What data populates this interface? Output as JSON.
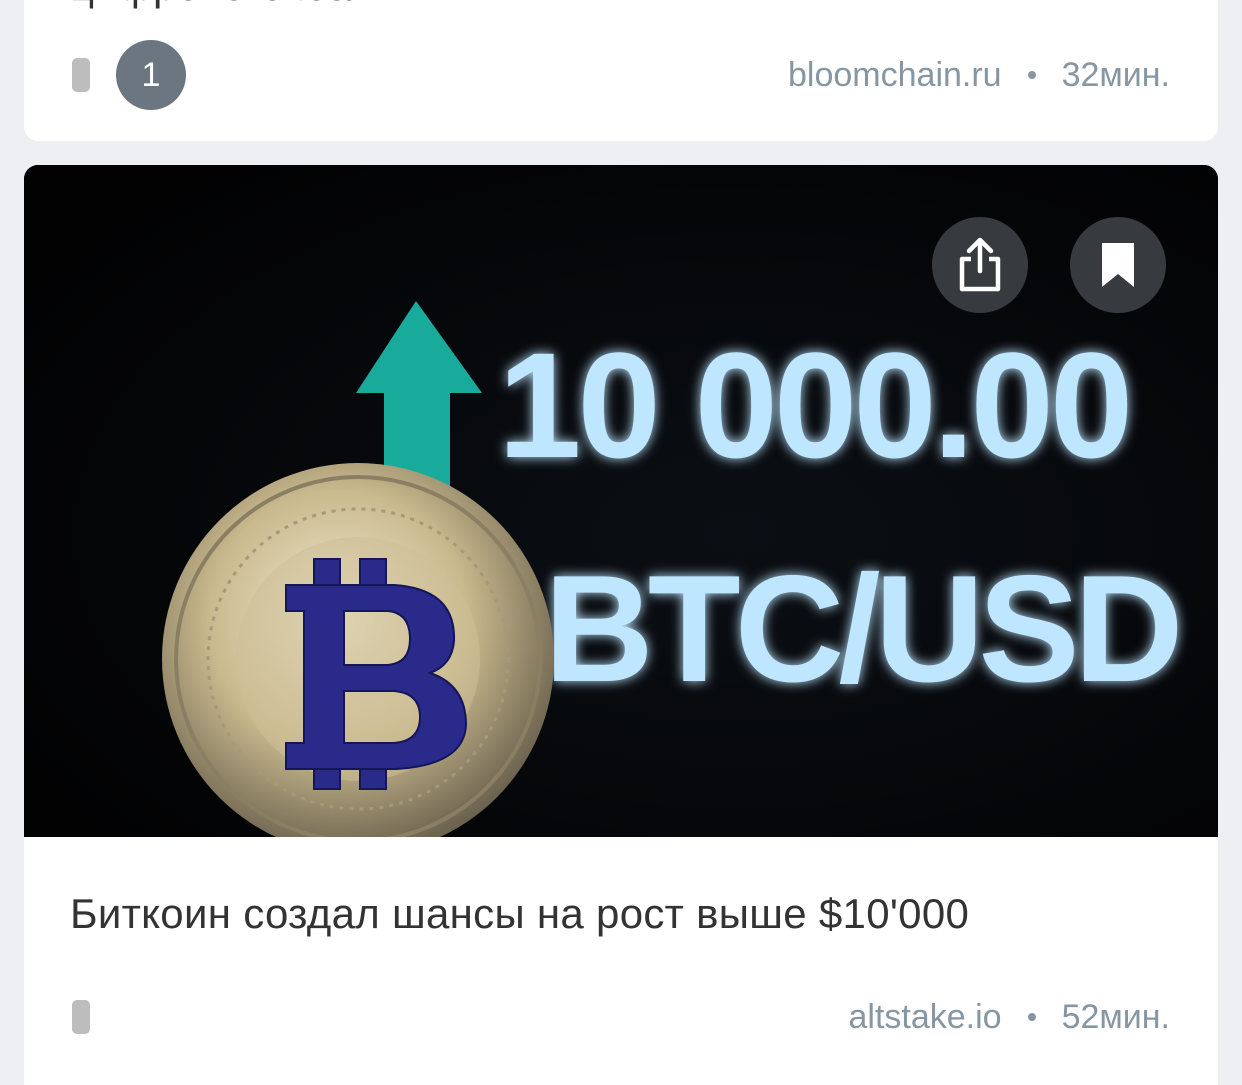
{
  "card1": {
    "title": "цифрового юаня",
    "comment_count": "1",
    "source": "bloomchain.ru",
    "time": "32мин."
  },
  "card2": {
    "image": {
      "headline_value": "10 000.00",
      "headline_pair": "BTC/USD"
    },
    "title": "Биткоин создал шансы на рост выше $10'000",
    "source": "altstake.io",
    "time": "52мин."
  },
  "colors": {
    "background": "#eeeff2",
    "card": "#ffffff",
    "meta_text": "#8696a2",
    "title_text": "#333333",
    "badge": "#6b7680",
    "glow_text": "#bfe6ff",
    "arrow": "#19b3a3",
    "coin_gold": "#c9b98d",
    "coin_b": "#2a2a8a"
  },
  "icons": {
    "share": "share-icon",
    "bookmark": "bookmark-icon",
    "drag": "drag-handle-icon"
  }
}
